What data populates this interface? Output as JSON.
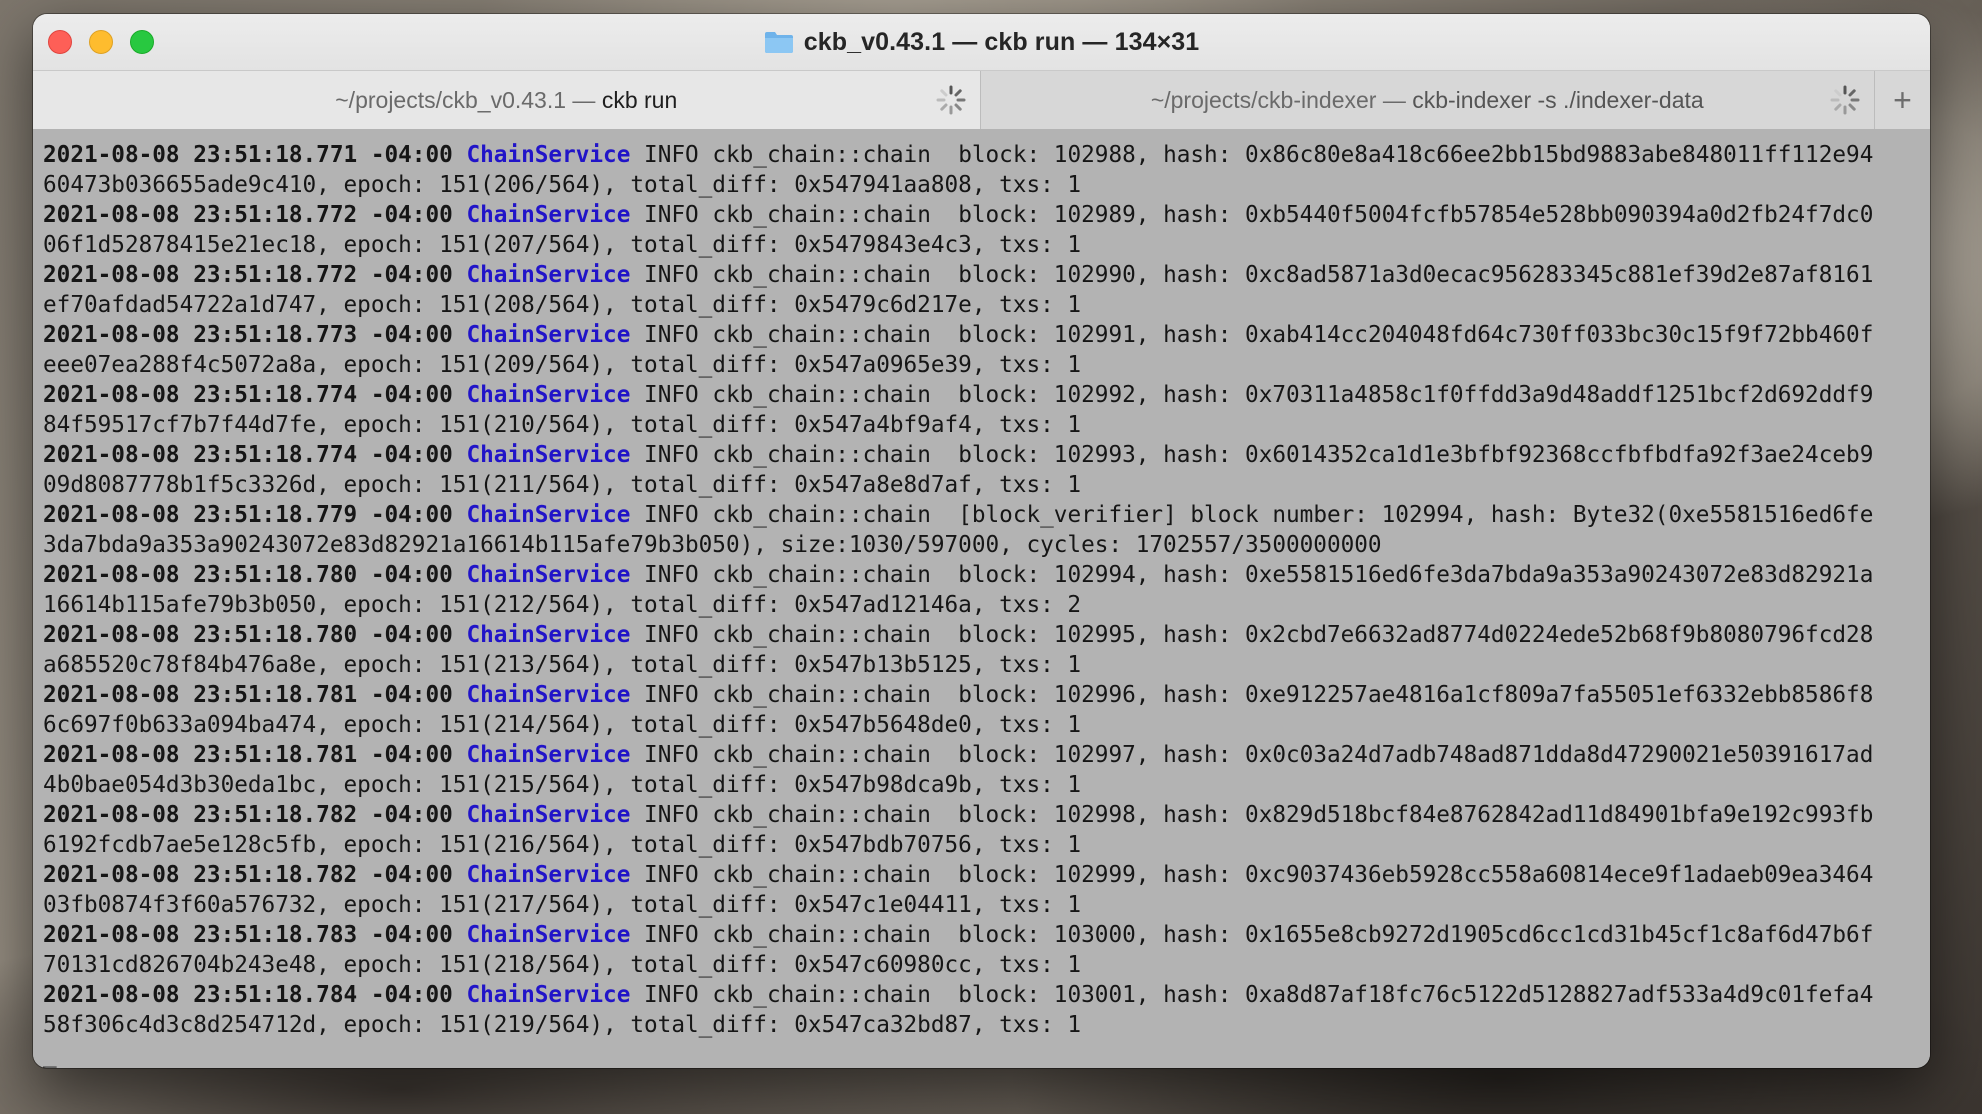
{
  "window": {
    "title": "ckb_v0.43.1 — ckb run — 134×31"
  },
  "tabs": [
    {
      "path": "~/projects/ckb_v0.43.1 — ",
      "command": "ckb run",
      "active": true
    },
    {
      "path": "~/projects/ckb-indexer — ",
      "command": "ckb-indexer -s ./indexer-data",
      "active": false
    }
  ],
  "new_tab_label": "+",
  "terminal": {
    "lines": [
      {
        "ts": "2021-08-08 23:51:18.771 -04:00",
        "svc": "ChainService",
        "text": " INFO ckb_chain::chain  block: 102988, hash: 0x86c80e8a418c66ee2bb15bd9883abe848011ff112e94"
      },
      {
        "text": "60473b036655ade9c410, epoch: 151(206/564), total_diff: 0x547941aa808, txs: 1"
      },
      {
        "ts": "2021-08-08 23:51:18.772 -04:00",
        "svc": "ChainService",
        "text": " INFO ckb_chain::chain  block: 102989, hash: 0xb5440f5004fcfb57854e528bb090394a0d2fb24f7dc0"
      },
      {
        "text": "06f1d52878415e21ec18, epoch: 151(207/564), total_diff: 0x5479843e4c3, txs: 1"
      },
      {
        "ts": "2021-08-08 23:51:18.772 -04:00",
        "svc": "ChainService",
        "text": " INFO ckb_chain::chain  block: 102990, hash: 0xc8ad5871a3d0ecac956283345c881ef39d2e87af8161"
      },
      {
        "text": "ef70afdad54722a1d747, epoch: 151(208/564), total_diff: 0x5479c6d217e, txs: 1"
      },
      {
        "ts": "2021-08-08 23:51:18.773 -04:00",
        "svc": "ChainService",
        "text": " INFO ckb_chain::chain  block: 102991, hash: 0xab414cc204048fd64c730ff033bc30c15f9f72bb460f"
      },
      {
        "text": "eee07ea288f4c5072a8a, epoch: 151(209/564), total_diff: 0x547a0965e39, txs: 1"
      },
      {
        "ts": "2021-08-08 23:51:18.774 -04:00",
        "svc": "ChainService",
        "text": " INFO ckb_chain::chain  block: 102992, hash: 0x70311a4858c1f0ffdd3a9d48addf1251bcf2d692ddf9"
      },
      {
        "text": "84f59517cf7b7f44d7fe, epoch: 151(210/564), total_diff: 0x547a4bf9af4, txs: 1"
      },
      {
        "ts": "2021-08-08 23:51:18.774 -04:00",
        "svc": "ChainService",
        "text": " INFO ckb_chain::chain  block: 102993, hash: 0x6014352ca1d1e3bfbf92368ccfbfbdfa92f3ae24ceb9"
      },
      {
        "text": "09d8087778b1f5c3326d, epoch: 151(211/564), total_diff: 0x547a8e8d7af, txs: 1"
      },
      {
        "ts": "2021-08-08 23:51:18.779 -04:00",
        "svc": "ChainService",
        "text": " INFO ckb_chain::chain  [block_verifier] block number: 102994, hash: Byte32(0xe5581516ed6fe"
      },
      {
        "text": "3da7bda9a353a90243072e83d82921a16614b115afe79b3b050), size:1030/597000, cycles: 1702557/3500000000"
      },
      {
        "ts": "2021-08-08 23:51:18.780 -04:00",
        "svc": "ChainService",
        "text": " INFO ckb_chain::chain  block: 102994, hash: 0xe5581516ed6fe3da7bda9a353a90243072e83d82921a"
      },
      {
        "text": "16614b115afe79b3b050, epoch: 151(212/564), total_diff: 0x547ad12146a, txs: 2"
      },
      {
        "ts": "2021-08-08 23:51:18.780 -04:00",
        "svc": "ChainService",
        "text": " INFO ckb_chain::chain  block: 102995, hash: 0x2cbd7e6632ad8774d0224ede52b68f9b8080796fcd28"
      },
      {
        "text": "a685520c78f84b476a8e, epoch: 151(213/564), total_diff: 0x547b13b5125, txs: 1"
      },
      {
        "ts": "2021-08-08 23:51:18.781 -04:00",
        "svc": "ChainService",
        "text": " INFO ckb_chain::chain  block: 102996, hash: 0xe912257ae4816a1cf809a7fa55051ef6332ebb8586f8"
      },
      {
        "text": "6c697f0b633a094ba474, epoch: 151(214/564), total_diff: 0x547b5648de0, txs: 1"
      },
      {
        "ts": "2021-08-08 23:51:18.781 -04:00",
        "svc": "ChainService",
        "text": " INFO ckb_chain::chain  block: 102997, hash: 0x0c03a24d7adb748ad871dda8d47290021e50391617ad"
      },
      {
        "text": "4b0bae054d3b30eda1bc, epoch: 151(215/564), total_diff: 0x547b98dca9b, txs: 1"
      },
      {
        "ts": "2021-08-08 23:51:18.782 -04:00",
        "svc": "ChainService",
        "text": " INFO ckb_chain::chain  block: 102998, hash: 0x829d518bcf84e8762842ad11d84901bfa9e192c993fb"
      },
      {
        "text": "6192fcdb7ae5e128c5fb, epoch: 151(216/564), total_diff: 0x547bdb70756, txs: 1"
      },
      {
        "ts": "2021-08-08 23:51:18.782 -04:00",
        "svc": "ChainService",
        "text": " INFO ckb_chain::chain  block: 102999, hash: 0xc9037436eb5928cc558a60814ece9f1adaeb09ea3464"
      },
      {
        "text": "03fb0874f3f60a576732, epoch: 151(217/564), total_diff: 0x547c1e04411, txs: 1"
      },
      {
        "ts": "2021-08-08 23:51:18.783 -04:00",
        "svc": "ChainService",
        "text": " INFO ckb_chain::chain  block: 103000, hash: 0x1655e8cb9272d1905cd6cc1cd31b45cf1c8af6d47b6f"
      },
      {
        "text": "70131cd826704b243e48, epoch: 151(218/564), total_diff: 0x547c60980cc, txs: 1"
      },
      {
        "ts": "2021-08-08 23:51:18.784 -04:00",
        "svc": "ChainService",
        "text": " INFO ckb_chain::chain  block: 103001, hash: 0xa8d87af18fc76c5122d5128827adf533a4d9c01fefa4"
      },
      {
        "text": "58f306c4d3c8d254712d, epoch: 151(219/564), total_diff: 0x547ca32bd87, txs: 1"
      }
    ],
    "cursor": "_"
  },
  "colors": {
    "service": "#2114c8",
    "terminal_bg": "#b3b3b3",
    "close": "#fe5f57",
    "minimize": "#febc2e",
    "maximize": "#28c840"
  },
  "icons": [
    "folder-icon",
    "spinner-icon",
    "plus-icon"
  ]
}
